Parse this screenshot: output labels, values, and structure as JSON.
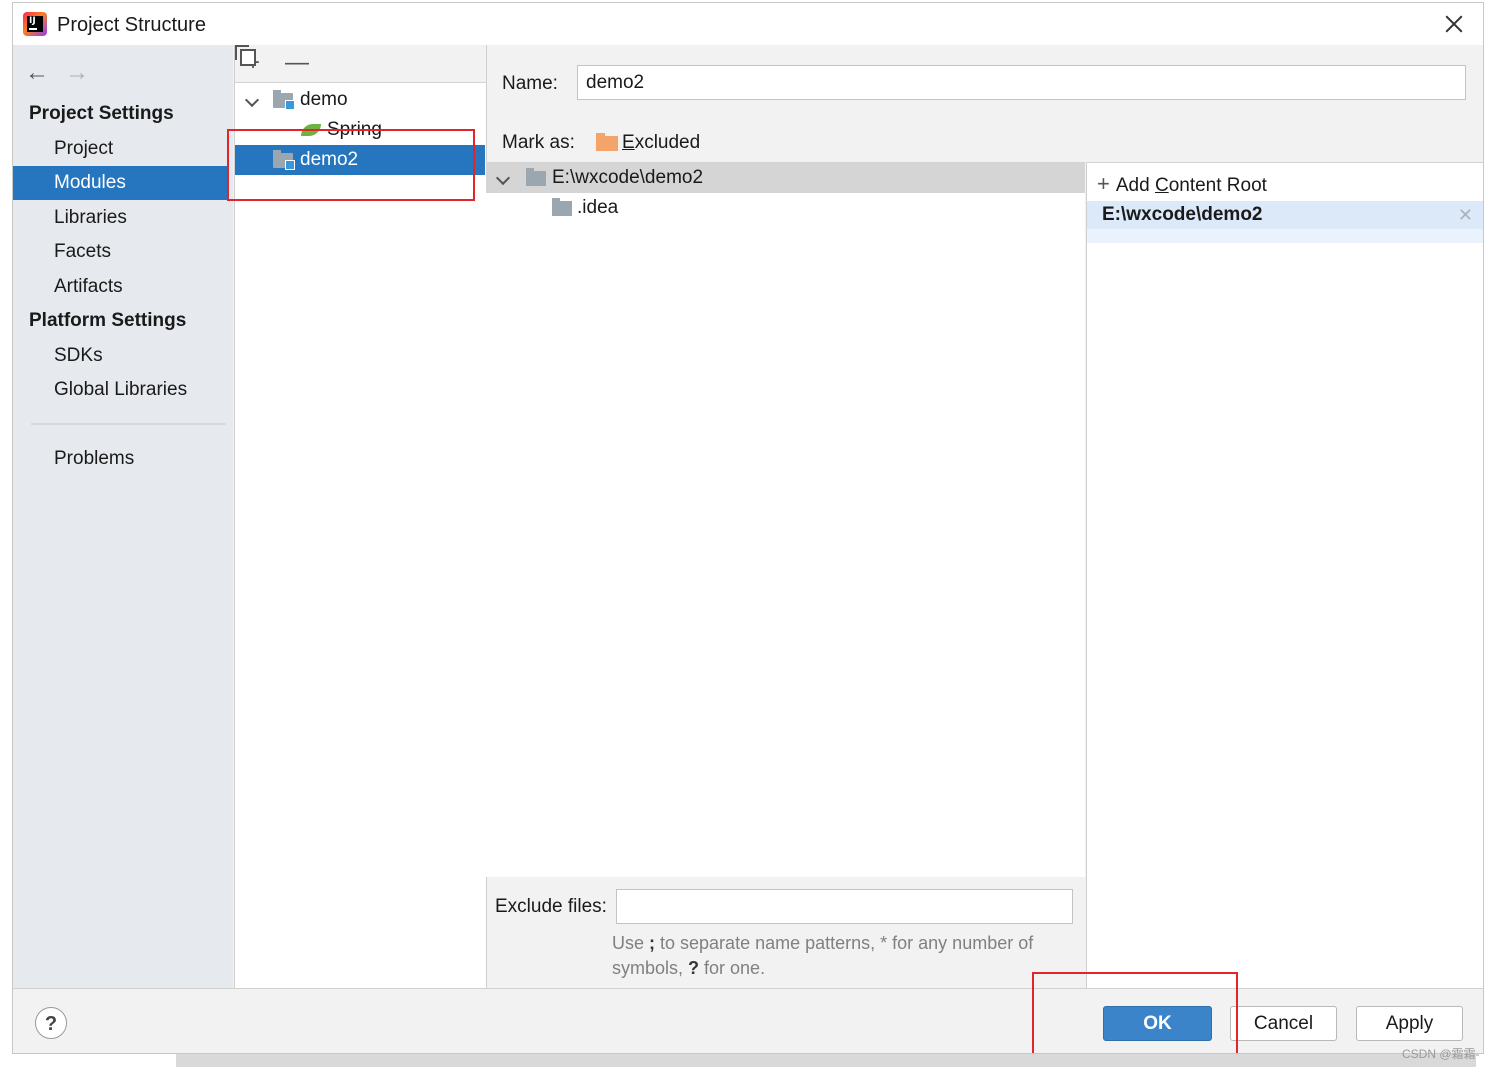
{
  "window": {
    "title": "Project Structure"
  },
  "sidebar": {
    "project_settings_title": "Project Settings",
    "project_items": [
      {
        "label": "Project"
      },
      {
        "label": "Modules",
        "selected": true
      },
      {
        "label": "Libraries"
      },
      {
        "label": "Facets"
      },
      {
        "label": "Artifacts"
      }
    ],
    "platform_settings_title": "Platform Settings",
    "platform_items": [
      {
        "label": "SDKs"
      },
      {
        "label": "Global Libraries"
      }
    ],
    "problems_label": "Problems"
  },
  "modules": {
    "toolbar_icons": [
      "add-icon",
      "remove-icon",
      "copy-icon"
    ],
    "tree": [
      {
        "label": "demo",
        "expanded": true
      },
      {
        "label": "Spring",
        "child_of": "demo"
      },
      {
        "label": "demo2",
        "selected": true
      }
    ]
  },
  "module_detail": {
    "name_label": "Name:",
    "name_value": "demo2",
    "mark_as_label": "Mark as:",
    "mark_as_mnemonic": "E",
    "mark_as_rest": "xcluded",
    "content_tree": [
      {
        "label": "E:\\wxcode\\demo2",
        "expanded": true
      },
      {
        "label": ".idea"
      }
    ],
    "add_content_root_pre": "Add ",
    "add_content_root_mnemonic": "C",
    "add_content_root_rest": "ontent Root",
    "content_root_path": "E:\\wxcode\\demo2",
    "exclude_files_label": "Exclude files:",
    "exclude_files_value": "",
    "hint_use": "Use ",
    "hint_sep": ";",
    "hint_mid": " to separate name patterns, * for any number of symbols, ",
    "hint_q": "?",
    "hint_end": " for one."
  },
  "footer": {
    "help_label": "?",
    "ok_label": "OK",
    "cancel_label": "Cancel",
    "apply_label": "Apply"
  },
  "watermark": "CSDN @霜霜-",
  "colors": {
    "selection": "#2675bf",
    "ok_button": "#3c84c9",
    "highlight_box": "#e0262b",
    "excluded_folder": "#f4a46b"
  }
}
